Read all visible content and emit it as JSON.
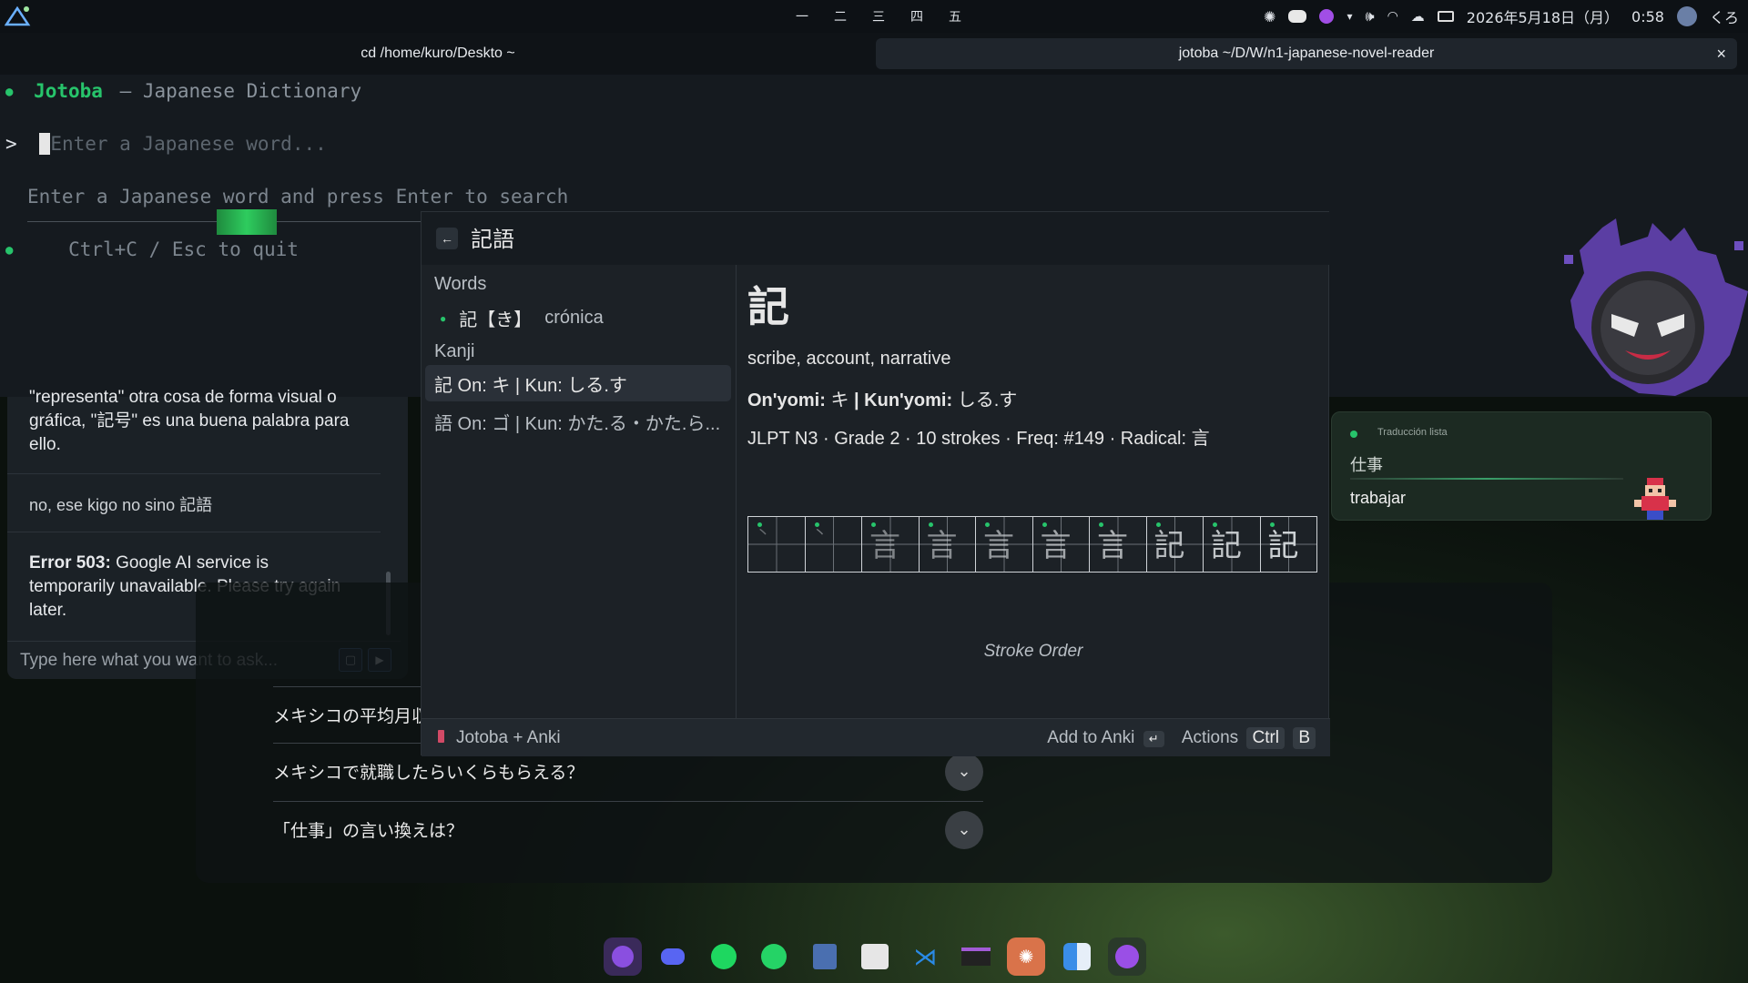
{
  "topbar": {
    "workspaces": [
      "一",
      "二",
      "三",
      "四",
      "五"
    ],
    "datetime": "2026年5月18日（月）",
    "time": "0:58",
    "user": "くろ"
  },
  "tabs": [
    {
      "title": "cd /home/kuro/Deskto ~"
    },
    {
      "title": "jotoba ~/D/W/n1-japanese-novel-reader",
      "close": "×"
    }
  ],
  "terminal": {
    "bullet": "●",
    "app_name": "Jotoba",
    "app_subtitle": "— Japanese Dictionary",
    "prompt": ">",
    "input_placeholder": "Enter a Japanese word...",
    "hint": "Enter a Japanese word and press Enter to search",
    "quit_hint": "Ctrl+C / Esc to quit"
  },
  "chat": {
    "partial_message": "\"representa\" otra cosa de forma visual o gráfica, \"記号\" es una buena palabra para ello.",
    "user_message": "no, ese kigo no sino 記語",
    "error_label": "Error 503:",
    "error_text": "Google AI service is temporarily unavailable. Please try again later.",
    "input_placeholder": "Type here what you want to ask..."
  },
  "questions": [
    {
      "text": "メキシコの平均月収は？"
    },
    {
      "text": "メキシコで就職したらいくらもらえる？"
    },
    {
      "text": "「仕事」の言い換えは？"
    }
  ],
  "jotoba": {
    "back": "←",
    "query": "記語",
    "words_header": "Words",
    "word_entry": "記【き】",
    "word_meaning": "crónica",
    "kanji_header": "Kanji",
    "kanji_items": [
      {
        "text": "記 On: キ | Kun: しる.す"
      },
      {
        "text": "語 On: ゴ | Kun: かた.る・かた.ら..."
      }
    ],
    "detail": {
      "kanji": "記",
      "meaning": "scribe, account, narrative",
      "onyomi_label": "On'yomi:",
      "onyomi": "キ",
      "kunyomi_label": "Kun'yomi:",
      "kunyomi": "しる.す",
      "info": "JLPT N3 · Grade 2 · 10 strokes · Freq: #149 · Radical: 言",
      "stroke_caption": "Stroke Order",
      "stroke_count": 10
    },
    "footer": {
      "brand": "Jotoba + Anki",
      "add_label": "Add to Anki",
      "add_key": "↵",
      "actions_label": "Actions",
      "key1": "Ctrl",
      "key2": "B"
    }
  },
  "translation_card": {
    "status": "Traducción lista",
    "source": "仕事",
    "target": "trabajar"
  },
  "dock": {
    "apps": [
      "tor-browser-icon",
      "discord-icon",
      "spotify-icon",
      "whatsapp-icon",
      "files-icon",
      "terminal-icon",
      "vscode-icon",
      "app-icon",
      "claude-icon",
      "finder-icon",
      "circle-app-icon"
    ]
  },
  "colors": {
    "accent_green": "#27c46b",
    "bg_terminal": "#151a1f",
    "popup_bg": "#1c2126"
  }
}
